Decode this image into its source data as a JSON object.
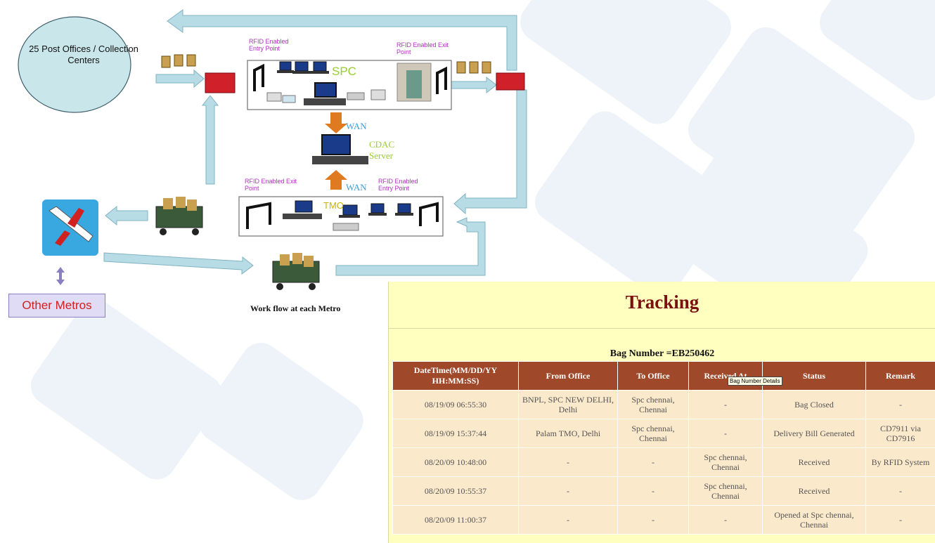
{
  "diagram": {
    "post_offices_label": "25 Post Offices / Collection Centers",
    "rfid_entry_label": "RFID Enabled Entry Point",
    "rfid_exit_label": "RFID Enabled Exit Point",
    "spc_label": "SPC",
    "tmo_label": "TMO",
    "wan_label": "WAN",
    "cdac_label": "CDAC Server",
    "other_metros_label": "Other Metros",
    "workflow_caption": "Work flow at each Metro",
    "colors": {
      "arrow": "#b8dce6",
      "box_border": "#555555",
      "circle": "#c9e6ea"
    }
  },
  "tracking": {
    "title": "Tracking",
    "bag_number": "Bag Number =EB250462",
    "columns": [
      "DateTime(MM/DD/YY HH:MM:SS)",
      "From Office",
      "To Office",
      "Received At",
      "Status",
      "Remark"
    ],
    "rows": [
      [
        "08/19/09 06:55:30",
        "BNPL, SPC NEW DELHI, Delhi",
        "Spc chennai, Chennai",
        "-",
        "Bag Closed",
        "-"
      ],
      [
        "08/19/09 15:37:44",
        "Palam TMO, Delhi",
        "Spc chennai, Chennai",
        "-",
        "Delivery Bill Generated",
        "CD7911 via CD7916"
      ],
      [
        "08/20/09 10:48:00",
        "-",
        "-",
        "Spc chennai, Chennai",
        "Received",
        "By RFID System"
      ],
      [
        "08/20/09 10:55:37",
        "-",
        "-",
        "Spc chennai, Chennai",
        "Received",
        "-"
      ],
      [
        "08/20/09 11:00:37",
        "-",
        "-",
        "-",
        "Opened at Spc chennai, Chennai",
        "-"
      ]
    ],
    "tooltip": "Bag Number Details",
    "colors": {
      "header_bg": "#a0482a",
      "cell_bg": "#fbe9cc",
      "panel_bg": "#ffffc0",
      "title": "#7a1010"
    }
  }
}
